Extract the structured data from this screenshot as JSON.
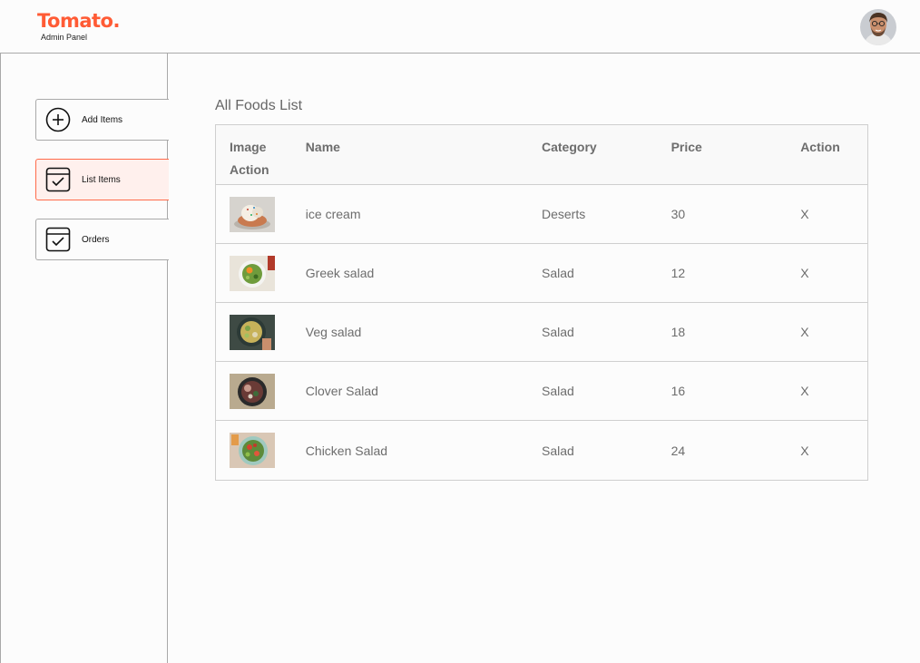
{
  "brand": {
    "title": "Tomato.",
    "subtitle": "Admin Panel",
    "accent": "#ff5b35"
  },
  "profile": {
    "icon": "avatar-photo"
  },
  "sidebar": {
    "items": [
      {
        "label": "Add Items",
        "icon": "add-circle-icon",
        "active": false
      },
      {
        "label": "List Items",
        "icon": "calendar-check-icon",
        "active": true
      },
      {
        "label": "Orders",
        "icon": "calendar-check-icon",
        "active": false
      }
    ]
  },
  "main": {
    "title": "All Foods List",
    "columns": [
      "Image",
      "Name",
      "Category",
      "Price",
      "Action"
    ],
    "header_wrap": "Action",
    "rows": [
      {
        "name": "ice cream",
        "category": "Deserts",
        "price": "30",
        "action": "X"
      },
      {
        "name": "Greek salad",
        "category": "Salad",
        "price": "12",
        "action": "X"
      },
      {
        "name": "Veg salad",
        "category": "Salad",
        "price": "18",
        "action": "X"
      },
      {
        "name": "Clover Salad",
        "category": "Salad",
        "price": "16",
        "action": "X"
      },
      {
        "name": "Chicken Salad",
        "category": "Salad",
        "price": "24",
        "action": "X"
      }
    ]
  }
}
